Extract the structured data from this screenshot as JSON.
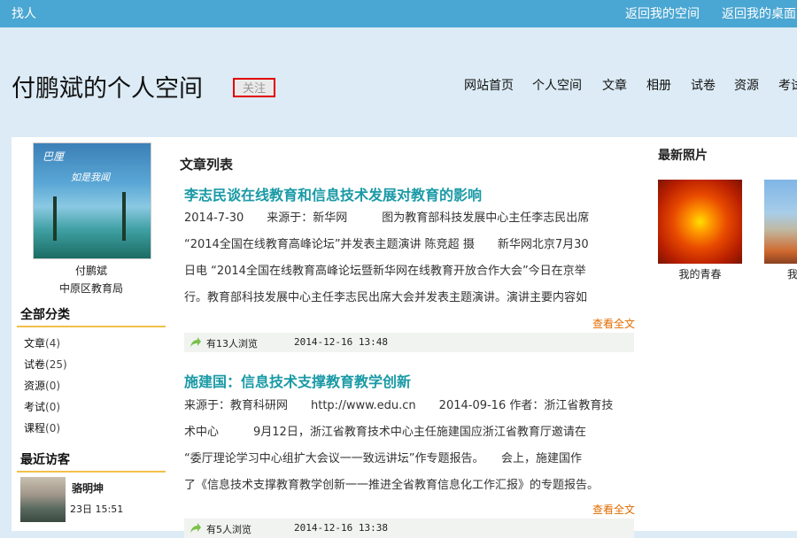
{
  "topbar": {
    "find": "找人",
    "back_space": "返回我的空间",
    "back_desktop": "返回我的桌面"
  },
  "header": {
    "title": "付鹏斌的个人空间",
    "follow": "关注",
    "nav": [
      "网站首页",
      "个人空间",
      "文章",
      "相册",
      "试卷",
      "资源",
      "考试"
    ]
  },
  "profile": {
    "avatar_caption_1": "巴厘",
    "avatar_caption_2": "如是我闻",
    "name": "付鹏斌",
    "org": "中原区教育局"
  },
  "categories": {
    "title": "全部分类",
    "items": [
      {
        "label": "文章",
        "count": "(4)"
      },
      {
        "label": "试卷",
        "count": "(25)"
      },
      {
        "label": "资源",
        "count": "(0)"
      },
      {
        "label": "考试",
        "count": "(0)"
      },
      {
        "label": "课程",
        "count": "(0)"
      }
    ]
  },
  "visitors": {
    "title": "最近访客",
    "items": [
      {
        "name": "骆明坤",
        "time": "23日 15:51"
      }
    ]
  },
  "articles": {
    "title": "文章列表",
    "read_more": "查看全文",
    "items": [
      {
        "title": "李志民谈在线教育和信息技术发展对教育的影响",
        "lines": [
          "2014-7-30　　来源于：新华网　　　图为教育部科技发展中心主任李志民出席",
          "“2014全国在线教育高峰论坛”并发表主题演讲 陈竞超 摄　　新华网北京7月30",
          "日电 “2014全国在线教育高峰论坛暨新华网在线教育开放合作大会”今日在京举",
          "行。教育部科技发展中心主任李志民出席大会并发表主题演讲。演讲主要内容如"
        ],
        "views": "有13人浏览",
        "time": "2014-12-16 13:48"
      },
      {
        "title": "施建国：信息技术支撑教育教学创新",
        "lines": [
          " 来源于：教育科研网　　http://www.edu.cn　　2014-09-16 作者：浙江省教育技",
          "术中心　　　9月12日，浙江省教育技术中心主任施建国应浙江省教育厅邀请在",
          "“委厅理论学习中心组扩大会议一一致远讲坛”作专题报告。　　会上，施建国作",
          "了《信息技术支撑教育教学创新一一推进全省教育信息化工作汇报》的专题报告。"
        ],
        "views": "有5人浏览",
        "time": "2014-12-16 13:38"
      }
    ]
  },
  "photos": {
    "title": "最新照片",
    "items": [
      {
        "caption": "我的青春"
      },
      {
        "caption": "我"
      }
    ]
  },
  "colors": {
    "topbar": "#4aa6d2",
    "background": "#dcebf5",
    "article_title": "#1a9aa6",
    "read_more": "#e06c00",
    "section_underline": "#f2c04a",
    "follow_border": "#e00000"
  }
}
